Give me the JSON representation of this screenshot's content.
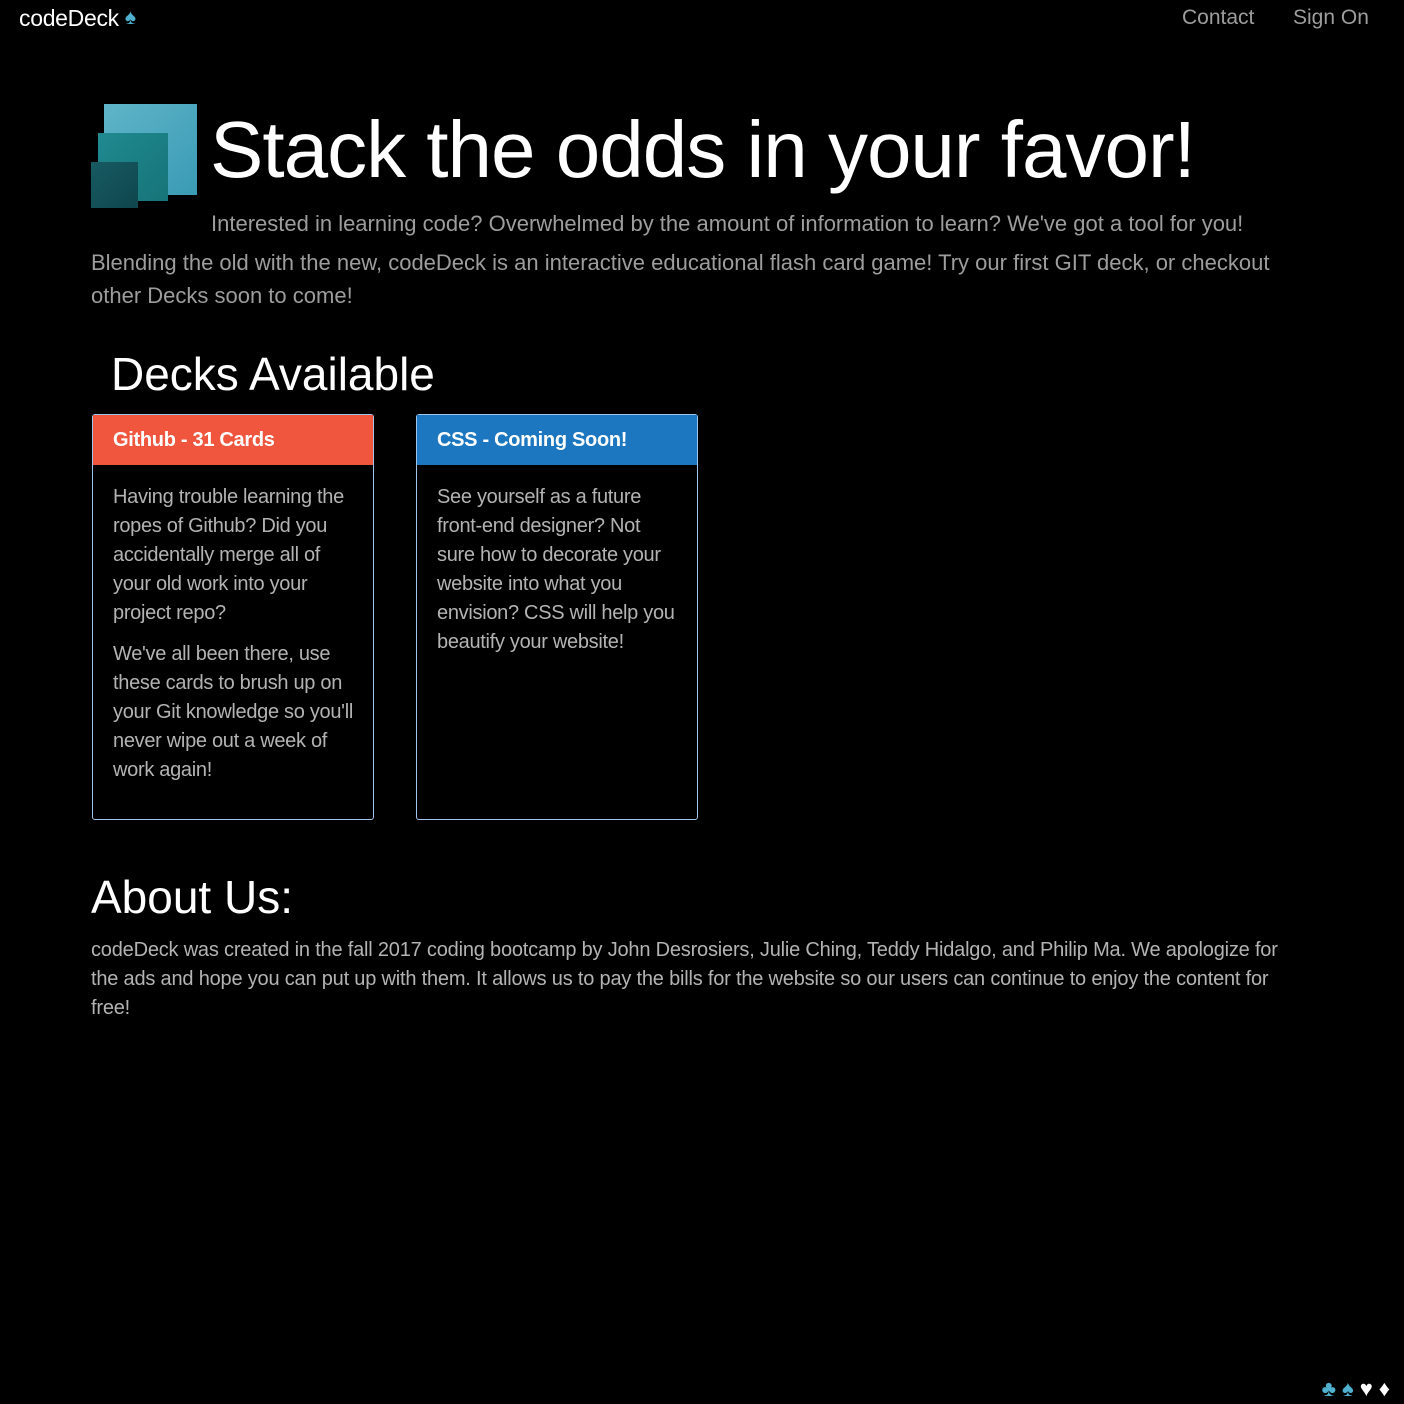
{
  "navbar": {
    "brand": "codeDeck",
    "brand_icon": "spade-icon",
    "links": [
      {
        "label": "Contact"
      },
      {
        "label": "Sign On"
      }
    ]
  },
  "hero": {
    "title": "Stack the odds in your favor!",
    "line1": "Interested in learning code? Overwhelmed by the amount of information to learn? We've got a tool for you!",
    "line2": "Blending the old with the new, codeDeck is an interactive educational flash card game! Try our first GIT deck, or checkout other Decks soon to come!"
  },
  "decks": {
    "heading": "Decks Available",
    "items": [
      {
        "title": "Github - 31 Cards",
        "paragraphs": [
          "Having trouble learning the ropes of Github? Did you accidentally merge all of your old work into your project repo?",
          "We've all been there, use these cards to brush up on your Git knowledge so you'll never wipe out a week of work again!"
        ]
      },
      {
        "title": "CSS - Coming Soon!",
        "paragraphs": [
          "See yourself as a future front-end designer? Not sure how to decorate your website into what you envision? CSS will help you beautify your website!"
        ]
      }
    ]
  },
  "about": {
    "heading": "About Us:",
    "text": "codeDeck was created in the fall 2017 coding bootcamp by John Desrosiers, Julie Ching, Teddy Hidalgo, and Philip Ma. We apologize for the ads and hope you can put up with them. It allows us to pay the bills for the website so our users can continue to enjoy the content for free!"
  },
  "footer": {
    "suits": [
      "club-icon",
      "spade-icon",
      "heart-icon",
      "diamond-icon"
    ]
  },
  "colors": {
    "background": "#000000",
    "github_header": "#f0553e",
    "css_header": "#1c77c0",
    "card_border": "#9fc6ea",
    "accent_blue": "#4fb0d0",
    "muted_text": "#9d9d9d"
  }
}
